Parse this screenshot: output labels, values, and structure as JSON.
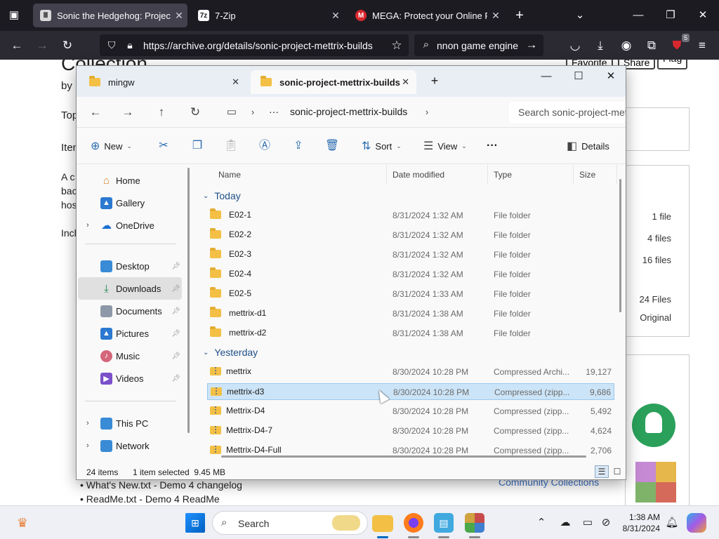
{
  "browser": {
    "tabs": [
      {
        "title": "Sonic the Hedgehog: Project M",
        "active": true,
        "favicon": "archive-icon"
      },
      {
        "title": "7-Zip",
        "active": false,
        "favicon": "7zip-icon"
      },
      {
        "title": "MEGA: Protect your Online Priv",
        "active": false,
        "favicon": "mega-icon"
      }
    ],
    "url": "https://archive.org/details/sonic-project-mettrix-builds",
    "search_text": "nnon game engine",
    "extensions_badge": "5"
  },
  "webpage": {
    "heading_fragment": "Collection",
    "by_fragment": "by",
    "top_fragment": "Top",
    "item_fragment": "Iten",
    "para_lines": [
      "A c",
      "bac",
      "hos"
    ],
    "incl_fragment": "Incl",
    "buttons": [
      "Favorite",
      "Share",
      "Flag"
    ],
    "stats": [
      "1 file",
      "4 files",
      "16 files",
      "24 Files",
      "Original"
    ],
    "bottom_list": [
      "What's New.txt - Demo 4 changelog",
      "ReadMe.txt - Demo 4 ReadMe"
    ],
    "community_link": "Community Collections"
  },
  "explorer": {
    "tabs": [
      {
        "label": "mingw",
        "active": false
      },
      {
        "label": "sonic-project-mettrix-builds",
        "active": true
      }
    ],
    "breadcrumb": {
      "ellipsis": "···",
      "folder": "sonic-project-mettrix-builds"
    },
    "search_placeholder": "Search sonic-project-mettrix-builds",
    "commands": {
      "new": "New",
      "sort": "Sort",
      "view": "View",
      "more": "···",
      "details": "Details"
    },
    "nav_pane": [
      {
        "label": "Home",
        "icon": "home-icon",
        "pinned": false,
        "expandable": false
      },
      {
        "label": "Gallery",
        "icon": "gallery-icon",
        "pinned": false,
        "expandable": false
      },
      {
        "label": "OneDrive",
        "icon": "onedrive-icon",
        "pinned": false,
        "expandable": true
      },
      {
        "label": "Desktop",
        "icon": "desktop-icon",
        "pinned": true,
        "expandable": false
      },
      {
        "label": "Downloads",
        "icon": "downloads-icon",
        "pinned": true,
        "expandable": false,
        "selected": true
      },
      {
        "label": "Documents",
        "icon": "documents-icon",
        "pinned": true,
        "expandable": false
      },
      {
        "label": "Pictures",
        "icon": "pictures-icon",
        "pinned": true,
        "expandable": false
      },
      {
        "label": "Music",
        "icon": "music-icon",
        "pinned": true,
        "expandable": false
      },
      {
        "label": "Videos",
        "icon": "videos-icon",
        "pinned": true,
        "expandable": false
      },
      {
        "label": "This PC",
        "icon": "this-pc-icon",
        "pinned": false,
        "expandable": true
      },
      {
        "label": "Network",
        "icon": "network-icon",
        "pinned": false,
        "expandable": true
      }
    ],
    "columns": [
      "Name",
      "Date modified",
      "Type",
      "Size"
    ],
    "groups": [
      {
        "label": "Today",
        "items": [
          {
            "name": "E02-1",
            "date": "8/31/2024 1:32 AM",
            "type": "File folder",
            "size": "",
            "kind": "folder"
          },
          {
            "name": "E02-2",
            "date": "8/31/2024 1:32 AM",
            "type": "File folder",
            "size": "",
            "kind": "folder"
          },
          {
            "name": "E02-3",
            "date": "8/31/2024 1:32 AM",
            "type": "File folder",
            "size": "",
            "kind": "folder"
          },
          {
            "name": "E02-4",
            "date": "8/31/2024 1:32 AM",
            "type": "File folder",
            "size": "",
            "kind": "folder"
          },
          {
            "name": "E02-5",
            "date": "8/31/2024 1:33 AM",
            "type": "File folder",
            "size": "",
            "kind": "folder"
          },
          {
            "name": "mettrix-d1",
            "date": "8/31/2024 1:38 AM",
            "type": "File folder",
            "size": "",
            "kind": "folder"
          },
          {
            "name": "mettrix-d2",
            "date": "8/31/2024 1:38 AM",
            "type": "File folder",
            "size": "",
            "kind": "folder"
          }
        ]
      },
      {
        "label": "Yesterday",
        "items": [
          {
            "name": "mettrix",
            "date": "8/30/2024 10:28 PM",
            "type": "Compressed Archi...",
            "size": "19,127",
            "kind": "zip"
          },
          {
            "name": "mettrix-d3",
            "date": "8/30/2024 10:28 PM",
            "type": "Compressed (zipp...",
            "size": "9,686",
            "kind": "zip",
            "selected": true
          },
          {
            "name": "Mettrix-D4",
            "date": "8/30/2024 10:28 PM",
            "type": "Compressed (zipp...",
            "size": "5,492",
            "kind": "zip"
          },
          {
            "name": "Mettrix-D4-7",
            "date": "8/30/2024 10:28 PM",
            "type": "Compressed (zipp...",
            "size": "4,624",
            "kind": "zip"
          },
          {
            "name": "Mettrix-D4-Full",
            "date": "8/30/2024 10:28 PM",
            "type": "Compressed (zipp...",
            "size": "2,706",
            "kind": "zip"
          }
        ]
      }
    ],
    "status": {
      "count": "24 items",
      "selection": "1 item selected  9.45 MB"
    }
  },
  "taskbar": {
    "search_label": "Search",
    "time": "1:38 AM",
    "date": "8/31/2024"
  }
}
